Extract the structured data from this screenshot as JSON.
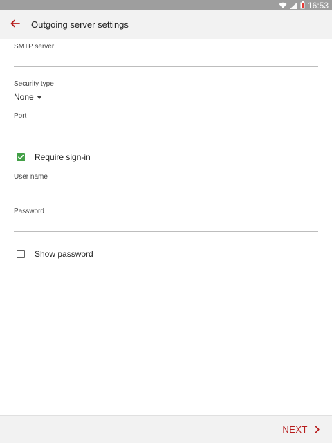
{
  "status_bar": {
    "time": "16:53",
    "icons": [
      "wifi-icon",
      "signal-icon",
      "battery-icon"
    ]
  },
  "header": {
    "title": "Outgoing server settings",
    "back_icon": "arrow-left-icon"
  },
  "form": {
    "smtp_server": {
      "label": "SMTP server",
      "value": ""
    },
    "security_type": {
      "label": "Security type",
      "value": "None"
    },
    "port": {
      "label": "Port",
      "value": ""
    },
    "require_signin": {
      "label": "Require sign-in",
      "checked": true
    },
    "user_name": {
      "label": "User name",
      "value": ""
    },
    "password": {
      "label": "Password",
      "value": ""
    },
    "show_password": {
      "label": "Show password",
      "checked": false
    }
  },
  "footer": {
    "next_label": "NEXT",
    "next_icon": "chevron-right-icon"
  },
  "colors": {
    "accent": "#b71c1c",
    "active_underline": "#e53935",
    "checkbox_checked": "#43a047",
    "status_bar": "#9e9e9e",
    "app_bar": "#f2f2f2"
  }
}
